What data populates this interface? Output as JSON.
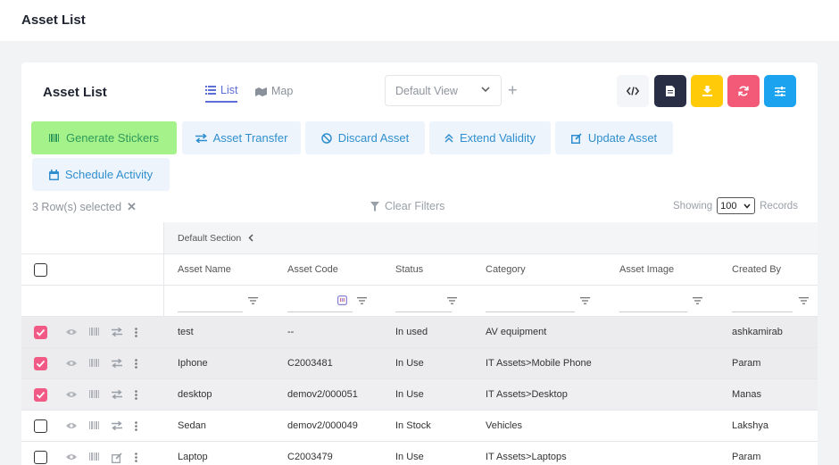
{
  "page": {
    "title": "Asset List"
  },
  "card": {
    "title": "Asset List",
    "tabs": [
      {
        "label": "List"
      },
      {
        "label": "Map"
      }
    ],
    "view_select": {
      "value": "Default View"
    },
    "plus": "+",
    "colors": {
      "dark": "#2a2e45",
      "yellow": "#ffca08",
      "pink": "#f25a78",
      "blue": "#1ba3ef",
      "green_active": "#a6f28a"
    }
  },
  "actions": [
    {
      "label": "Generate Stickers"
    },
    {
      "label": "Asset Transfer"
    },
    {
      "label": "Discard Asset"
    },
    {
      "label": "Extend Validity"
    },
    {
      "label": "Update Asset"
    },
    {
      "label": "Schedule Activity"
    }
  ],
  "toolbar": {
    "selected": "3 Row(s) selected",
    "clear_filters": "Clear Filters",
    "showing": "Showing",
    "records_value": "100",
    "records": "Records"
  },
  "table": {
    "section": "Default Section",
    "headers": [
      "Asset Name",
      "Asset Code",
      "Status",
      "Category",
      "Asset Image",
      "Created By"
    ],
    "rows": [
      {
        "name": "test",
        "code": "--",
        "status": "In used",
        "category": "AV equipment",
        "created_by": "ashkamirab",
        "checked": true
      },
      {
        "name": "Iphone",
        "code": "C2003481",
        "status": "In Use",
        "category": "IT Assets>Mobile Phone",
        "created_by": "Param",
        "checked": true
      },
      {
        "name": "desktop",
        "code": "demov2/000051",
        "status": "In Use",
        "category": "IT Assets>Desktop",
        "created_by": "Manas",
        "checked": true
      },
      {
        "name": "Sedan",
        "code": "demov2/000049",
        "status": "In Stock",
        "category": "Vehicles",
        "created_by": "Lakshya",
        "checked": false
      },
      {
        "name": "Laptop",
        "code": "C2003479",
        "status": "In Use",
        "category": "IT Assets>Laptops",
        "created_by": "Param",
        "checked": false
      }
    ]
  }
}
